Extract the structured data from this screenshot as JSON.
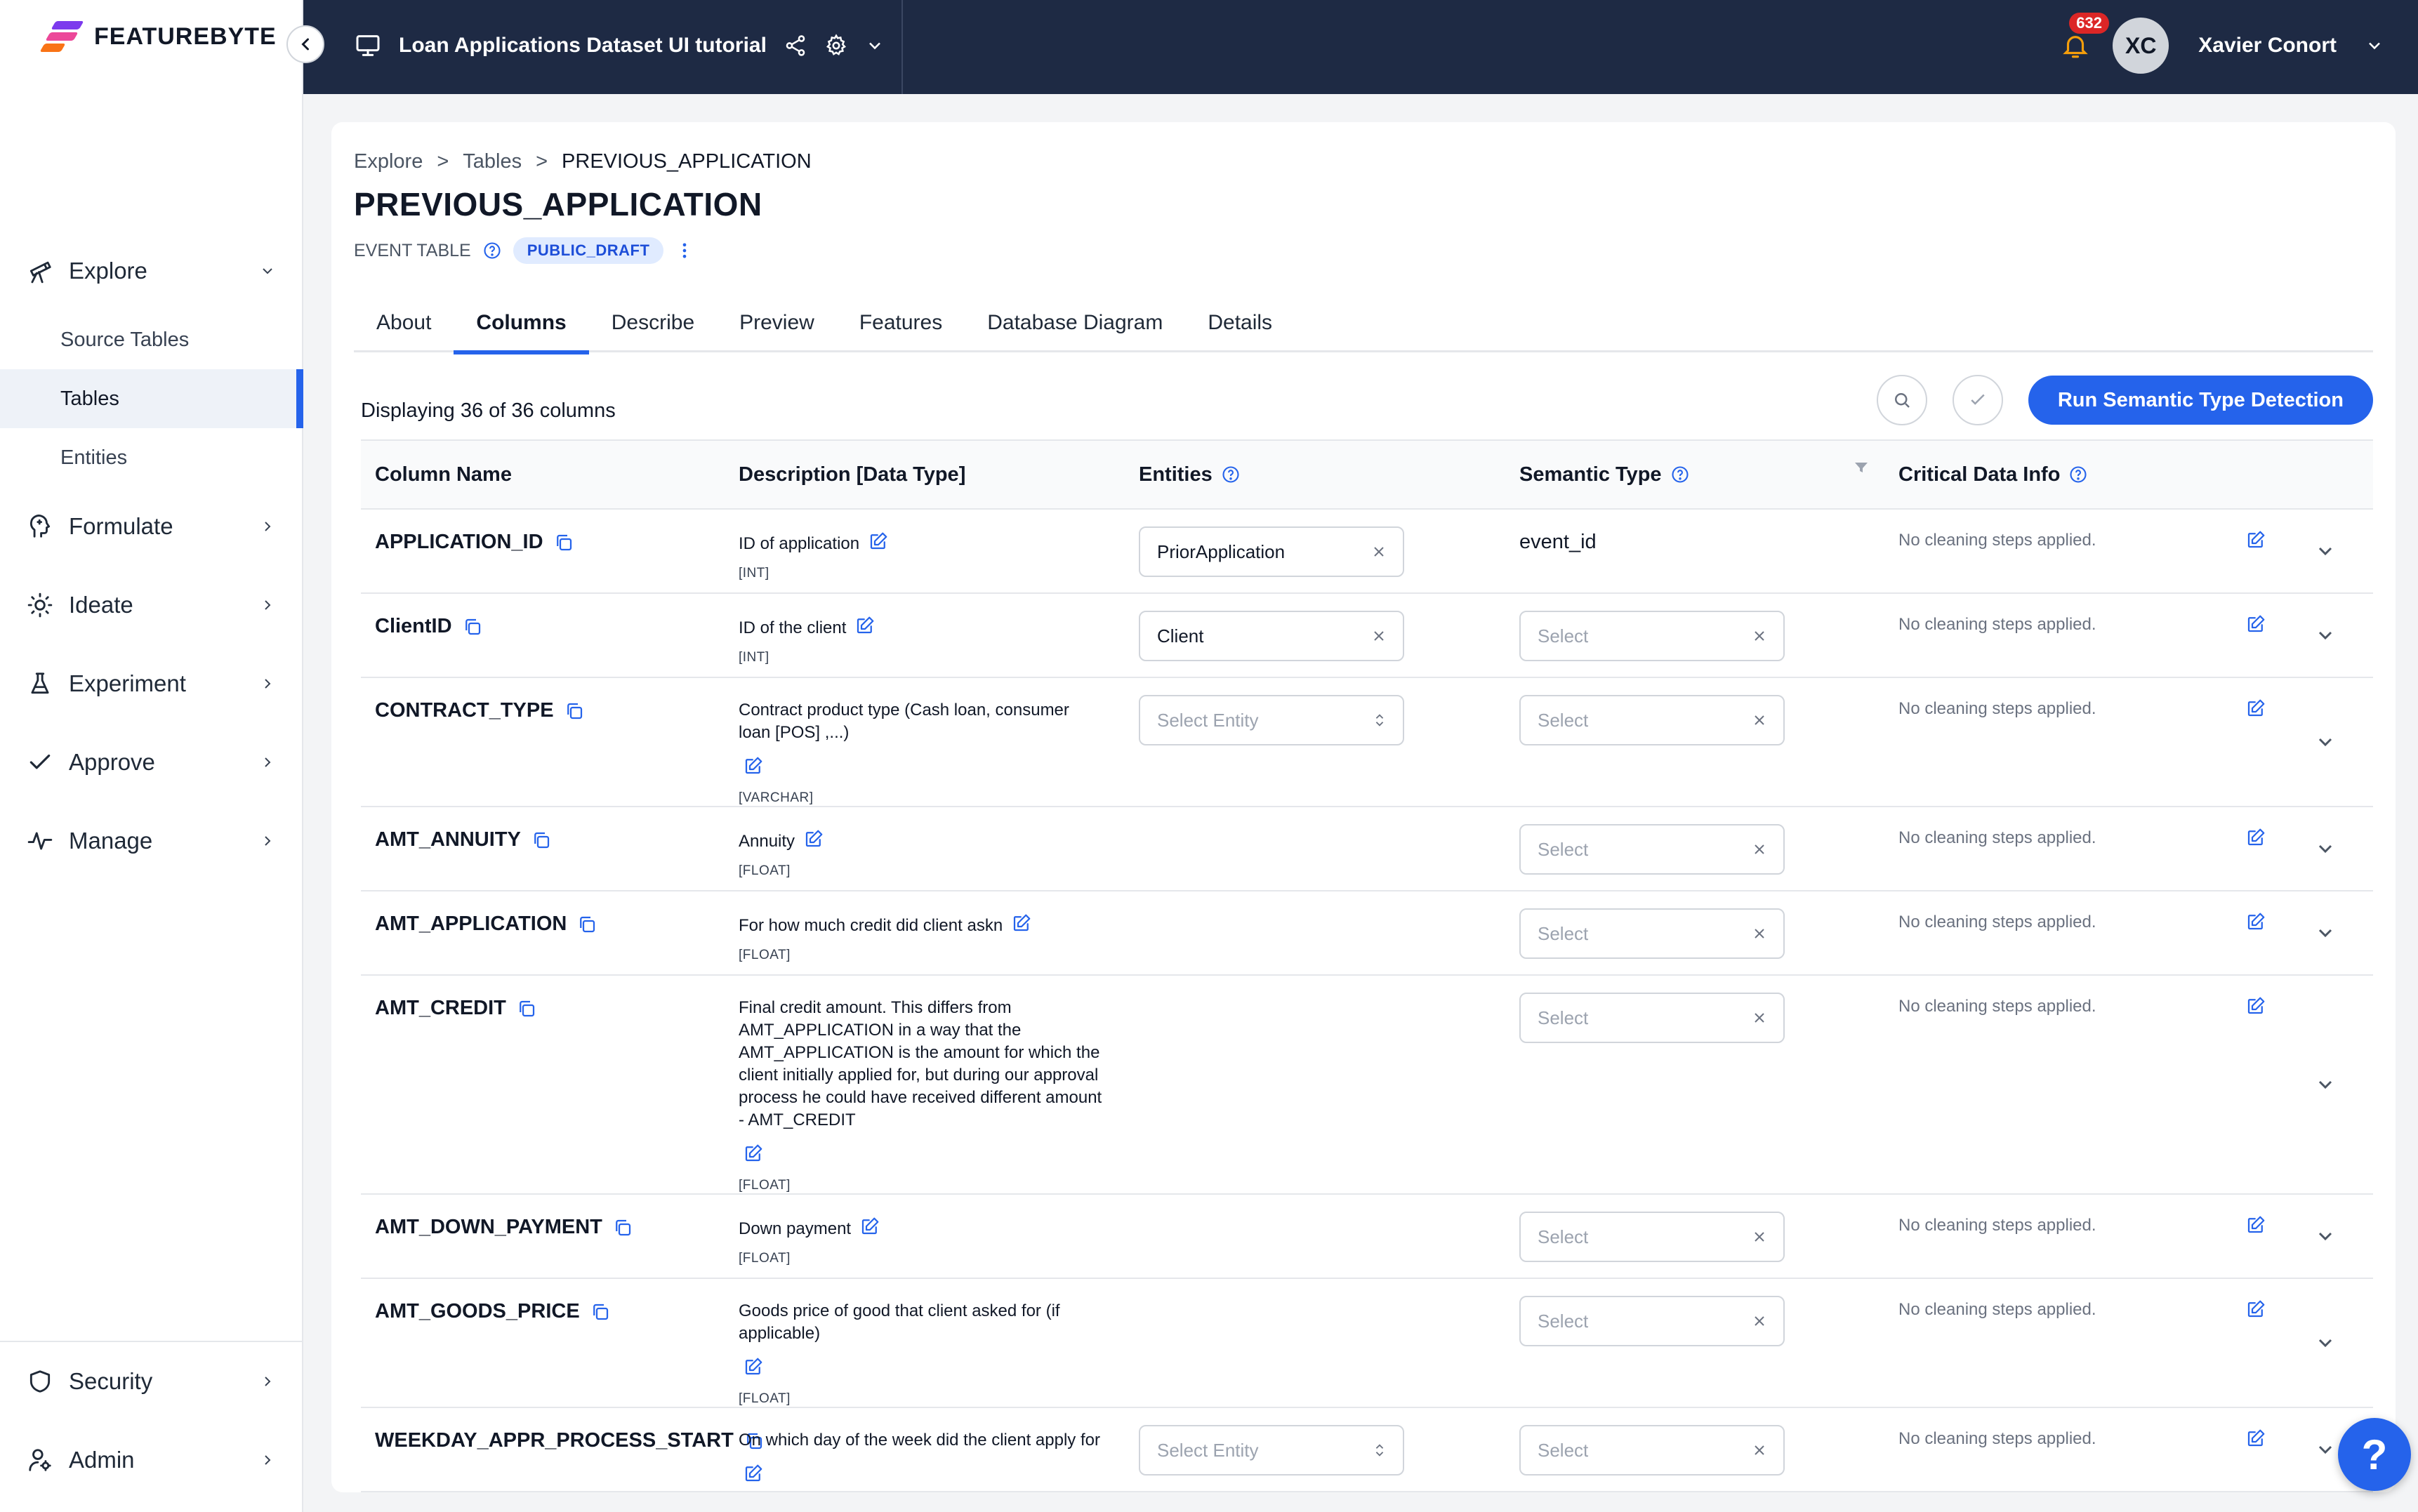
{
  "brand": {
    "name": "FEATUREBYTE"
  },
  "topbar": {
    "project_title": "Loan Applications Dataset UI tutorial",
    "notification_count": "632",
    "user_initials": "XC",
    "user_name": "Xavier Conort"
  },
  "sidebar": {
    "explore": "Explore",
    "sub": [
      "Source Tables",
      "Tables",
      "Entities"
    ],
    "items": [
      "Formulate",
      "Ideate",
      "Experiment",
      "Approve",
      "Manage"
    ],
    "bottom": [
      "Security",
      "Admin"
    ]
  },
  "breadcrumb": [
    "Explore",
    "Tables",
    "PREVIOUS_APPLICATION"
  ],
  "breadcrumb_sep": ">",
  "page": {
    "title": "PREVIOUS_APPLICATION",
    "table_type": "EVENT TABLE",
    "status": "PUBLIC_DRAFT"
  },
  "tabs": [
    "About",
    "Columns",
    "Describe",
    "Preview",
    "Features",
    "Database Diagram",
    "Details"
  ],
  "toolbar": {
    "count_text": "Displaying 36 of 36 columns",
    "run_button": "Run Semantic Type Detection"
  },
  "table": {
    "headers": [
      "Column Name",
      "Description [Data Type]",
      "Entities",
      "Semantic Type",
      "Critical Data Info"
    ],
    "rows": [
      {
        "name": "APPLICATION_ID",
        "desc": "ID of application",
        "dtype": "[INT]",
        "entity": "PriorApplication",
        "semantic": "event_id",
        "cleaning": "No cleaning steps applied."
      },
      {
        "name": "ClientID",
        "desc": "ID of the client",
        "dtype": "[INT]",
        "entity": "Client",
        "semantic_placeholder": "Select",
        "cleaning": "No cleaning steps applied."
      },
      {
        "name": "CONTRACT_TYPE",
        "desc": "Contract product type (Cash loan, consumer loan [POS] ,...)",
        "dtype": "[VARCHAR]",
        "entity_placeholder": "Select Entity",
        "semantic_placeholder": "Select",
        "cleaning": "No cleaning steps applied."
      },
      {
        "name": "AMT_ANNUITY",
        "desc": "Annuity",
        "dtype": "[FLOAT]",
        "semantic_placeholder": "Select",
        "cleaning": "No cleaning steps applied."
      },
      {
        "name": "AMT_APPLICATION",
        "desc": "For how much credit did client askn",
        "dtype": "[FLOAT]",
        "semantic_placeholder": "Select",
        "cleaning": "No cleaning steps applied."
      },
      {
        "name": "AMT_CREDIT",
        "desc": "Final credit amount. This differs from AMT_APPLICATION in a way that the AMT_APPLICATION is the amount for which the client initially applied for, but during our approval process he could have received different amount - AMT_CREDIT",
        "dtype": "[FLOAT]",
        "semantic_placeholder": "Select",
        "cleaning": "No cleaning steps applied."
      },
      {
        "name": "AMT_DOWN_PAYMENT",
        "desc": "Down payment",
        "dtype": "[FLOAT]",
        "semantic_placeholder": "Select",
        "cleaning": "No cleaning steps applied."
      },
      {
        "name": "AMT_GOODS_PRICE",
        "desc": "Goods price of good that client asked for (if applicable)",
        "dtype": "[FLOAT]",
        "semantic_placeholder": "Select",
        "cleaning": "No cleaning steps applied."
      },
      {
        "name": "WEEKDAY_APPR_PROCESS_START",
        "desc": "On which day of the week did the client apply for",
        "entity_placeholder": "Select Entity",
        "semantic_placeholder": "Select",
        "cleaning": "No cleaning steps applied."
      }
    ]
  },
  "help_fab": "?",
  "colors": {
    "primary": "#2563eb",
    "topbar": "#1e2a44",
    "badge": "#dc2626",
    "status_badge_bg": "#e0ebff"
  }
}
